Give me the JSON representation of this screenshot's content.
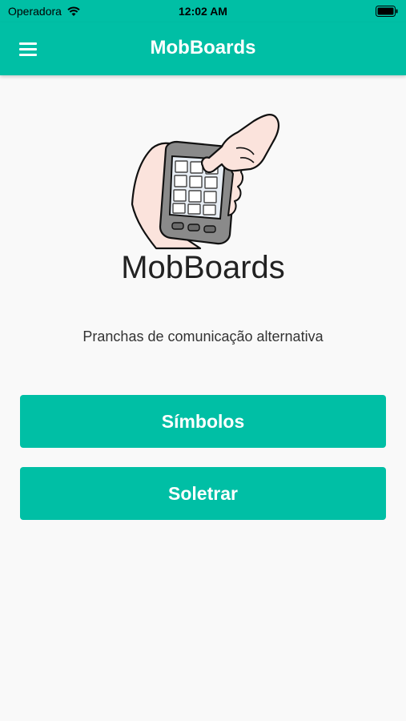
{
  "status_bar": {
    "carrier": "Operadora",
    "time": "12:02 AM"
  },
  "header": {
    "title": "MobBoards",
    "menu_icon": "hamburger-menu-icon"
  },
  "main": {
    "illustration_icon": "hand-holding-device-icon",
    "app_name": "MobBoards",
    "tagline": "Pranchas de comunicação alternativa",
    "buttons": [
      {
        "label": "Símbolos"
      },
      {
        "label": "Soletrar"
      }
    ]
  },
  "colors": {
    "accent": "#00bfa5",
    "background": "#f9f9f9"
  }
}
